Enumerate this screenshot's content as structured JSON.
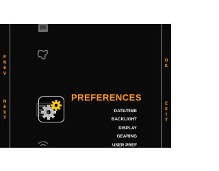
{
  "side_nav": {
    "prev_label": [
      "P",
      "R",
      "E",
      "V"
    ],
    "next_label": [
      "N",
      "E",
      "X",
      "T"
    ],
    "ok_label": [
      "O",
      "K"
    ],
    "exit_label": [
      "E",
      "X",
      "I",
      "T"
    ]
  },
  "carousel": {
    "items": [
      {
        "icon": "device-icon",
        "selected": false
      },
      {
        "icon": "route-icon",
        "selected": false
      },
      {
        "icon": "gears-icon",
        "selected": true
      },
      {
        "icon": "data-screen-icon",
        "selected": false
      },
      {
        "icon": "wireless-icon",
        "selected": false
      }
    ]
  },
  "preferences": {
    "title": "PREFERENCES",
    "items": [
      "DATE/TIME",
      "BACKLIGHT",
      "DISPLAY",
      "GEARING",
      "USER PREF"
    ]
  },
  "colors": {
    "accent": "#ff9a1e",
    "side_label": "#e8890f",
    "background": "#0a0a0a"
  }
}
